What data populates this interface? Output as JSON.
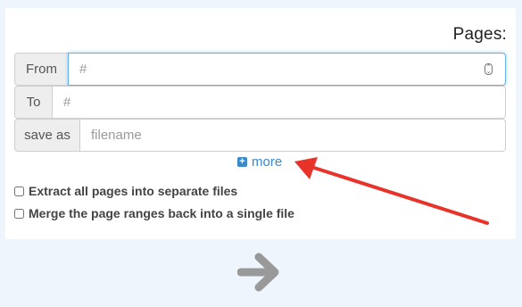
{
  "pages_title": "Pages:",
  "rows": {
    "from": {
      "label": "From",
      "value": "",
      "placeholder": "#"
    },
    "to": {
      "label": "To",
      "value": "",
      "placeholder": "#"
    },
    "save_as": {
      "label": "save as",
      "value": "",
      "placeholder": "filename"
    }
  },
  "more_link": {
    "label": "more",
    "icon": "plus-square-icon"
  },
  "options": {
    "extract_all": {
      "label": "Extract all pages into separate files",
      "checked": false
    },
    "merge_ranges": {
      "label": "Merge the page ranges back into a single file",
      "checked": false
    }
  },
  "next_button": {
    "icon": "arrow-right-icon"
  },
  "colors": {
    "accent": "#3a89c9",
    "annotation_arrow": "#e8332a",
    "page_background": "#eef5fd",
    "focus_border": "#66afe9"
  }
}
